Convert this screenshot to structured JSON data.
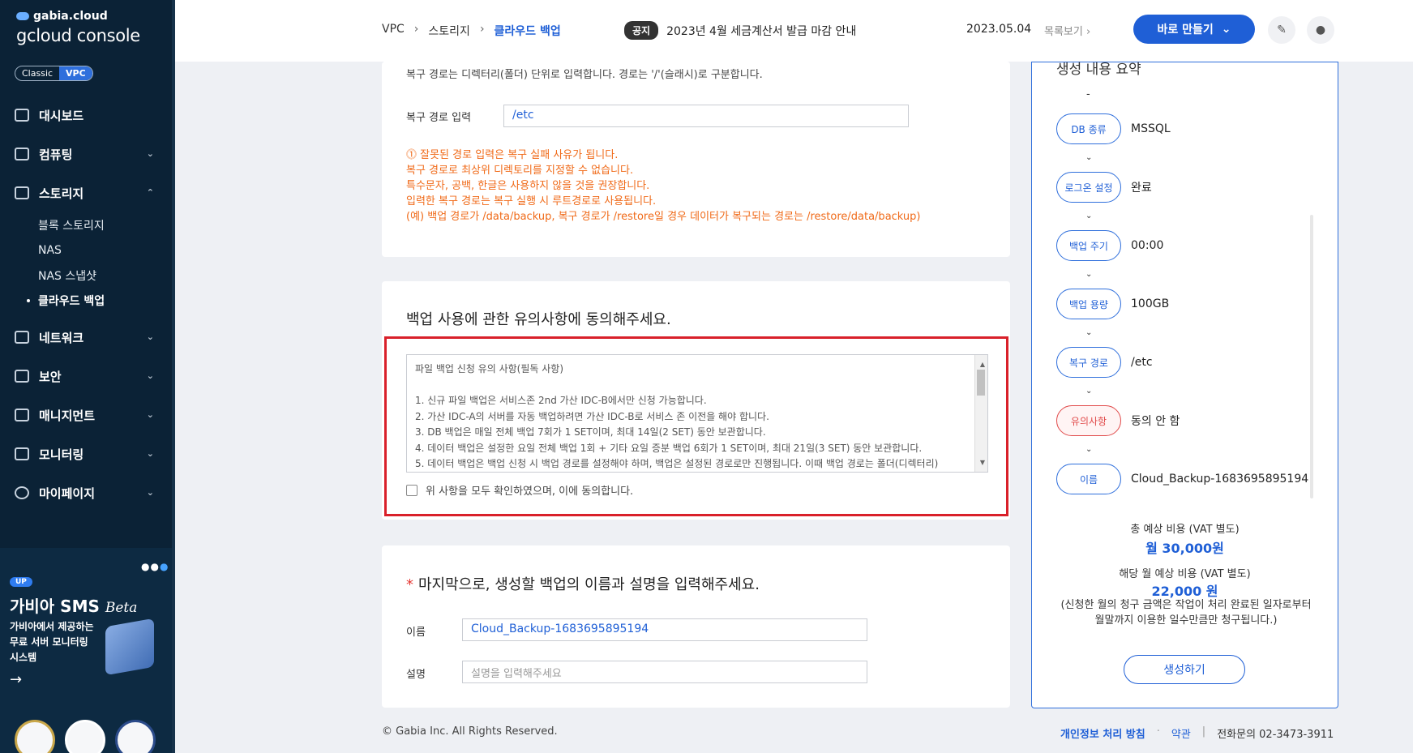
{
  "sidebar": {
    "brand_small": "gabia.cloud",
    "brand_big": "gcloud console",
    "mode": {
      "classic": "Classic",
      "vpc": "VPC"
    },
    "items": [
      {
        "label": "대시보드"
      },
      {
        "label": "컴퓨팅"
      },
      {
        "label": "스토리지"
      },
      {
        "label": "네트워크"
      },
      {
        "label": "보안"
      },
      {
        "label": "매니지먼트"
      },
      {
        "label": "모니터링"
      },
      {
        "label": "마이페이지"
      }
    ],
    "storage_sub": [
      "블록 스토리지",
      "NAS",
      "NAS 스냅샷",
      "클라우드 백업"
    ],
    "promo": {
      "badge": "UP",
      "title": "가비아 SMS",
      "title_suffix": "Beta",
      "desc": "가비아에서 제공하는 무료 서버 모니터링 시스템"
    }
  },
  "topbar": {
    "breadcrumb": [
      "VPC",
      "스토리지",
      "클라우드 백업"
    ],
    "notice_tag": "공지",
    "notice_text": "2023년 4월 세금계산서 발급 마감 안내",
    "notice_date": "2023.05.04",
    "notice_more": "목록보기",
    "create_label": "바로 만들기"
  },
  "restore": {
    "guide": "복구 경로는 디렉터리(폴더) 단위로 입력합니다. 경로는 '/'(슬래시)로 구분합니다.",
    "label": "복구 경로 입력",
    "value": "/etc",
    "warnings": [
      "⓵ 잘못된 경로 입력은 복구 실패 사유가 됩니다.",
      "복구 경로로 최상위 디렉토리를 지정할 수 없습니다.",
      "특수문자, 공백, 한글은 사용하지 않을 것을 권장합니다.",
      "입력한 복구 경로는 복구 실행 시 루트경로로 사용됩니다.",
      "(예) 백업 경로가 /data/backup, 복구 경로가 /restore일 경우 데이터가 복구되는 경로는 /restore/data/backup)"
    ]
  },
  "agreement": {
    "title": "백업 사용에 관한 유의사항에 동의해주세요.",
    "lines": [
      "파일 백업 신청 유의 사항(필독 사항)",
      "",
      "1. 신규 파일 백업은 서비스존 2nd 가산 IDC-B에서만 신청 가능합니다.",
      "2. 가산 IDC-A의 서버를 자동 백업하려면 가산 IDC-B로 서비스 존 이전을 해야 합니다.",
      "3. DB 백업은 매일 전체 백업 7회가 1 SET이며, 최대 14일(2 SET) 동안 보관합니다.",
      "4. 데이터 백업은 설정한 요일 전체 백업 1회 + 기타 요일 증분 백업 6회가 1 SET이며, 최대 21일(3 SET) 동안 보관합니다.",
      "5. 데이터 백업은 백업 신청 시 백업 경로를 설정해야 하며, 백업은 설정된 경로로만 진행됩니다. 이때 백업 경로는 폴더(디렉터리)"
    ],
    "checkbox_label": "위 사항을 모두 확인하였으며, 이에 동의합니다."
  },
  "naming": {
    "title": "마지막으로, 생성할 백업의 이름과 설명을 입력해주세요.",
    "required_mark": "*",
    "name_label": "이름",
    "name_value": "Cloud_Backup-1683695895194",
    "desc_label": "설명",
    "desc_placeholder": "설명을 입력해주세요"
  },
  "summary": {
    "title": "생성 내용 요약",
    "dash": "-",
    "rows": [
      {
        "pill": "DB 종류",
        "value": "MSSQL"
      },
      {
        "pill": "로그온 설정",
        "value": "완료"
      },
      {
        "pill": "백업 주기",
        "value": "00:00"
      },
      {
        "pill": "백업 용량",
        "value": "100GB"
      },
      {
        "pill": "복구 경로",
        "value": "/etc"
      },
      {
        "pill": "유의사항",
        "value": "동의 안 함"
      },
      {
        "pill": "이름",
        "value": "Cloud_Backup-1683695895194"
      }
    ],
    "total_label": "총 예상 비용 (VAT 별도)",
    "total_value": "월 30,000원",
    "month_label": "해당 월 예상 비용 (VAT 별도)",
    "month_value": "22,000 원",
    "note": "(신청한 월의 청구 금액은 작업이 처리 완료된 일자로부터 월말까지 이용한 일수만큼만 청구됩니다.)",
    "create_label": "생성하기"
  },
  "footer": {
    "copyright": "© Gabia Inc. All Rights Reserved.",
    "privacy": "개인정보 처리 방침",
    "terms": "약관",
    "phone": "전화문의  02-3473-3911"
  },
  "colors": {
    "accent": "#1f5fd6",
    "warning": "#f06a18",
    "highlight_border": "#d9202a",
    "sidebar": "#0b2236"
  }
}
